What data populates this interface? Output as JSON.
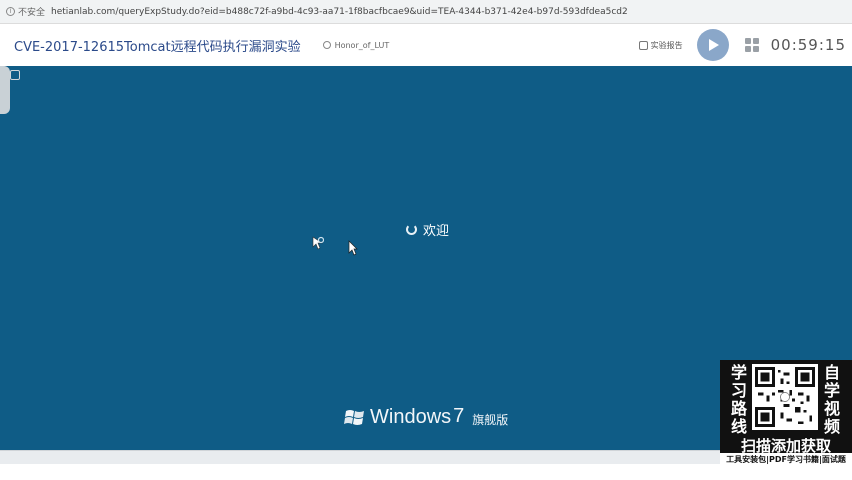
{
  "browser": {
    "security_label": "不安全",
    "url": "hetianlab.com/queryExpStudy.do?eid=b488c72f-a9bd-4c93-aa71-1f8bacfbcae9&uid=TEA-4344-b371-42e4-b97d-593dfdea5cd2"
  },
  "header": {
    "title": "CVE-2017-12615Tomcat远程代码执行漏洞实验",
    "user": "Honor_of_LUT",
    "report_label": "实验报告",
    "timer": "00:59:15"
  },
  "desktop": {
    "welcome": "欢迎",
    "brand_word": "Windows",
    "brand_version": "7",
    "brand_edition": "旗舰版",
    "background_color": "#0f5c86"
  },
  "promo": {
    "left_chars": [
      "学",
      "习",
      "路",
      "线"
    ],
    "right_chars": [
      "自",
      "学",
      "视",
      "频"
    ],
    "cta": "扫描添加获取",
    "sub": "工具安装包|PDF学习书籍|面试题"
  }
}
